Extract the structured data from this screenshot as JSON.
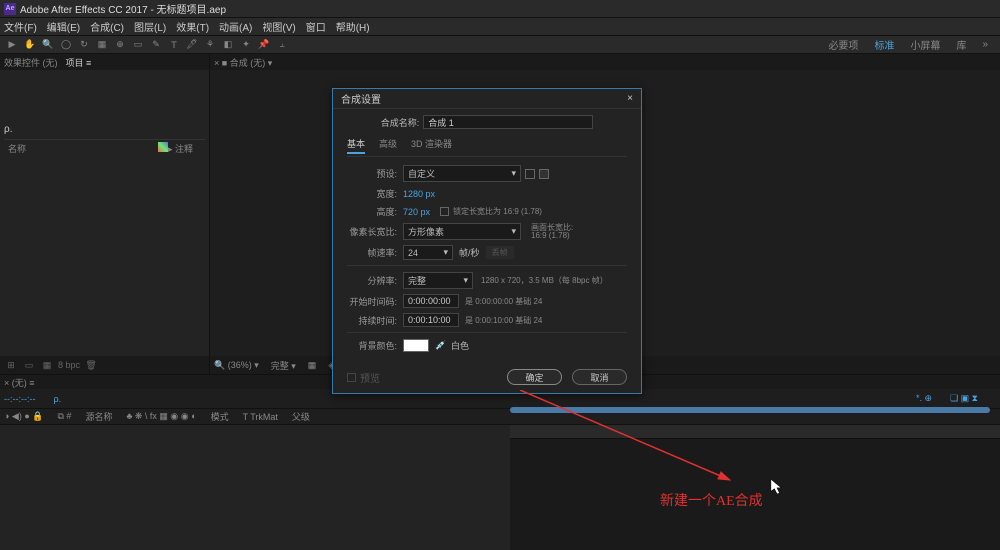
{
  "window": {
    "title": "Adobe After Effects CC 2017 - 无标题项目.aep"
  },
  "menu": [
    "文件(F)",
    "编辑(E)",
    "合成(C)",
    "图层(L)",
    "效果(T)",
    "动画(A)",
    "视图(V)",
    "窗口",
    "帮助(H)"
  ],
  "workspace": {
    "tabs": [
      "必要项",
      "标准",
      "小屏幕",
      "库"
    ],
    "activeIndex": 1,
    "moreIcon": "»"
  },
  "projectPanel": {
    "tabs": [
      "效果控件 (无)",
      "项目 ≡"
    ],
    "activeTab": 1,
    "headers": {
      "name": "名称",
      "tag": "▸ 注释"
    },
    "footer": {
      "bpc": "8 bpc"
    }
  },
  "viewer": {
    "tabs": [
      "× ■ 合成 (无) ▾"
    ],
    "footer": {
      "zoom": "🔍 (36%) ▾",
      "res": "完整 ▾"
    }
  },
  "dialog": {
    "title": "合成设置",
    "close": "×",
    "compNameLabel": "合成名称:",
    "compName": "合成 1",
    "tabs": [
      "基本",
      "高级",
      "3D 渲染器"
    ],
    "activeTab": 0,
    "preset": {
      "label": "预设:",
      "value": "自定义"
    },
    "width": {
      "label": "宽度:",
      "value": "1280 px"
    },
    "height": {
      "label": "高度:",
      "value": "720 px"
    },
    "lockAspect": {
      "text": "锁定长宽比为 16:9 (1.78)"
    },
    "pixelAspect": {
      "label": "像素长宽比:",
      "value": "方形像素",
      "right1": "画面长宽比:",
      "right2": "16:9 (1.78)"
    },
    "frameRate": {
      "label": "帧速率:",
      "value": "24",
      "unit": "帧/秒",
      "drop": "丢帧"
    },
    "resolution": {
      "label": "分辨率:",
      "value": "完整",
      "hint": "1280 x 720，3.5 MB（每 8bpc 帧）"
    },
    "startTimecode": {
      "label": "开始时间码:",
      "value": "0:00:00:00",
      "hint": "是 0:00:00:00 基础 24"
    },
    "duration": {
      "label": "持续时间:",
      "value": "0:00:10:00",
      "hint": "是 0:00:10:00 基础 24"
    },
    "bgColor": {
      "label": "背景颜色:",
      "name": "白色"
    },
    "preview": "预览",
    "ok": "确定",
    "cancel": "取消"
  },
  "timeline": {
    "tab": "× (无) ≡",
    "time": "--:--:--:--",
    "search": "ρ.",
    "ghost": "*. ⊕",
    "icons": "❏ ▣ ⧗",
    "cols": {
      "eye": "◑ ◀) ● 🔒",
      "num": "⧉ #",
      "src": "源名称",
      "sw": "♣ ❋ \\ fx ▦ ◉ ◉ ◐",
      "mode": "模式",
      "trkmat": "T   TrkMat",
      "parent": "父级"
    }
  },
  "annotation": {
    "text": "新建一个AE合成"
  }
}
